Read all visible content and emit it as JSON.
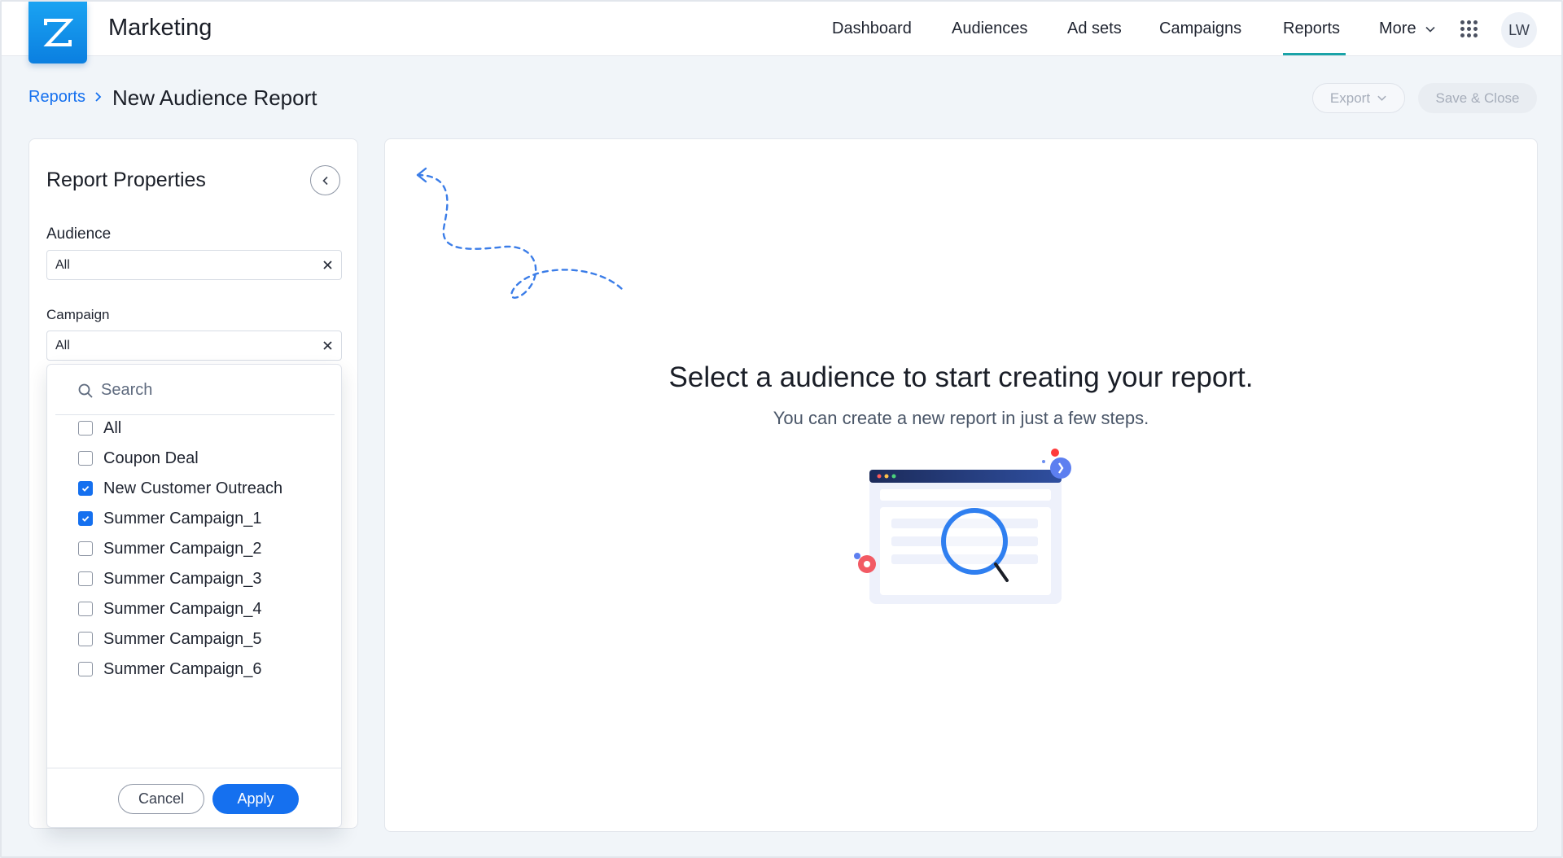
{
  "app": {
    "name": "Marketing",
    "logo_letter": "Z"
  },
  "nav": {
    "items": [
      "Dashboard",
      "Audiences",
      "Ad sets",
      "Campaigns",
      "Reports",
      "More"
    ],
    "active": "Reports",
    "user_initials": "LW"
  },
  "breadcrumb": {
    "parent": "Reports",
    "current": "New Audience Report"
  },
  "header_actions": {
    "export_label": "Export",
    "save_label": "Save & Close"
  },
  "report_properties": {
    "title": "Report Properties",
    "audience": {
      "label": "Audience",
      "value": "All"
    },
    "campaign": {
      "label": "Campaign",
      "value": "All"
    }
  },
  "campaign_dropdown": {
    "search_placeholder": "Search",
    "options": [
      {
        "label": "All",
        "checked": false
      },
      {
        "label": "Coupon Deal",
        "checked": false
      },
      {
        "label": "New Customer Outreach",
        "checked": true
      },
      {
        "label": "Summer Campaign_1",
        "checked": true
      },
      {
        "label": "Summer Campaign_2",
        "checked": false
      },
      {
        "label": "Summer Campaign_3",
        "checked": false
      },
      {
        "label": "Summer Campaign_4",
        "checked": false
      },
      {
        "label": "Summer Campaign_5",
        "checked": false
      },
      {
        "label": "Summer Campaign_6",
        "checked": false
      }
    ],
    "cancel_label": "Cancel",
    "apply_label": "Apply"
  },
  "empty_state": {
    "title": "Select a audience to start creating your report.",
    "subtitle": "You can create a new report in just a few steps."
  },
  "colors": {
    "accent": "#1570ef",
    "nav_active_underline": "#1aa3a8",
    "logo": "#0b8be8"
  },
  "icons": [
    "logo-icon",
    "chevron-down-icon",
    "apps-grid-icon",
    "chevron-right-icon",
    "chevron-left-icon",
    "close-icon",
    "search-icon",
    "check-icon",
    "magnifier-illustration",
    "dashed-arrow-illustration"
  ]
}
